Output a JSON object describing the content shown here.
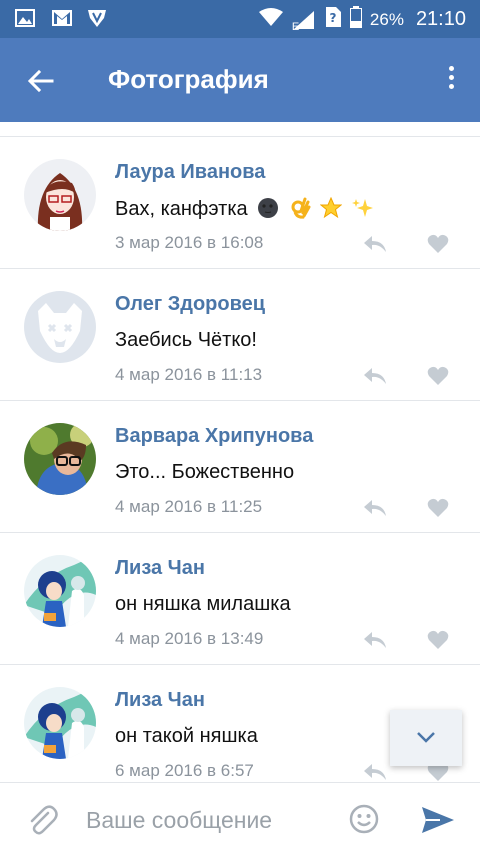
{
  "status_bar": {
    "battery": "26%",
    "time": "21:10",
    "carrier_letter": "E"
  },
  "app_bar": {
    "title": "Фотография"
  },
  "comments": [
    {
      "author": "Лаура Иванова",
      "text": "Вах, канфэтка",
      "date": "3 мар 2016 в 16:08",
      "avatar": "girl-glasses-avatar",
      "emojis": [
        "new-moon-face",
        "ok-hand",
        "star",
        "sparkles"
      ]
    },
    {
      "author": "Олег Здоровец",
      "text": "Заебись Чётко!",
      "date": "4 мар 2016 в 11:13",
      "avatar": "default-dog-avatar"
    },
    {
      "author": "Варвара Хрипунова",
      "text": "Это... Божественно",
      "date": "4 мар 2016 в 11:25",
      "avatar": "photo-avatar"
    },
    {
      "author": "Лиза Чан",
      "text": "он няшка милашка",
      "date": "4 мар 2016 в 13:49",
      "avatar": "anime-avatar"
    },
    {
      "author": "Лиза Чан",
      "text": "он такой няшка",
      "date": "6 мар 2016 в 6:57",
      "avatar": "anime-avatar"
    }
  ],
  "composer": {
    "placeholder": "Ваше сообщение"
  },
  "colors": {
    "header": "#4e7bbd",
    "status_bar": "#3a6aa6",
    "author": "#4a76a8",
    "date": "#8b939c"
  }
}
